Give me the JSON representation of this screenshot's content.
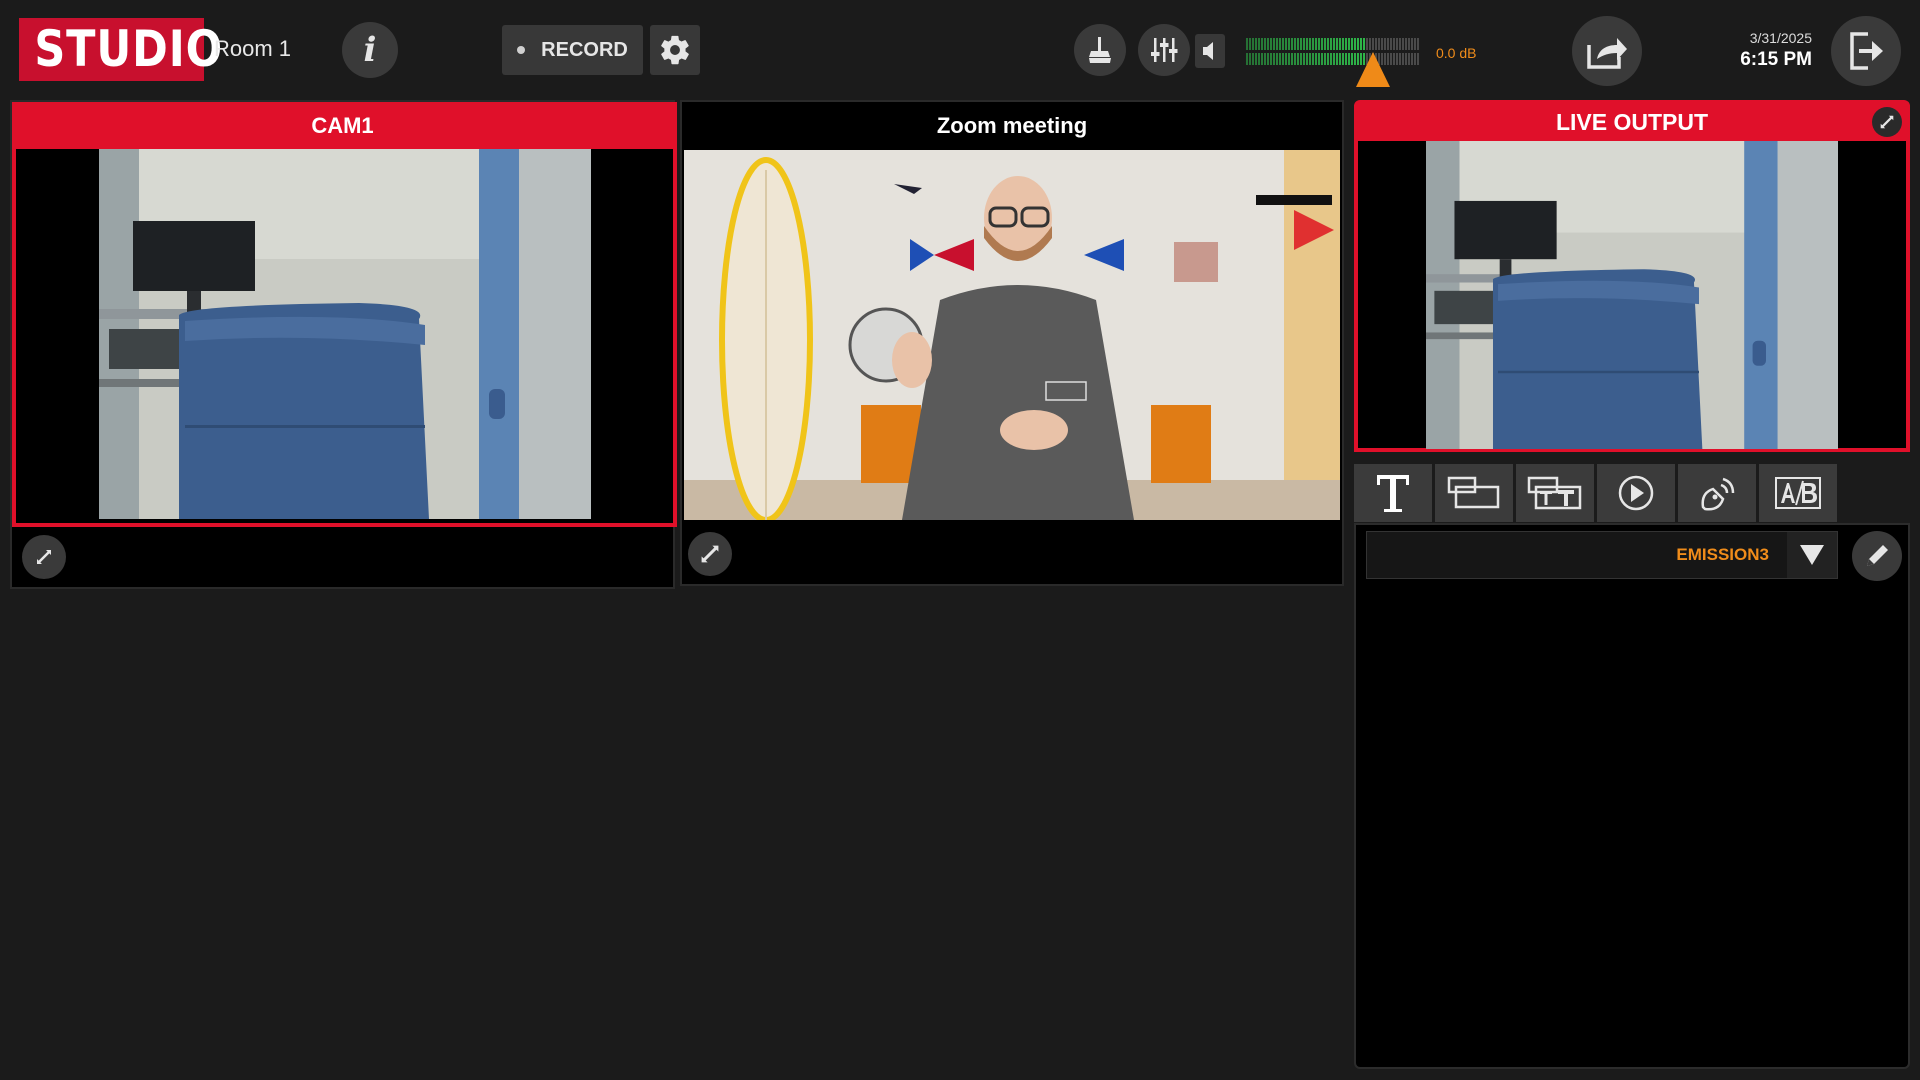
{
  "header": {
    "logo_text": "STUDIO",
    "room_name": "Room 1",
    "record_label": "RECORD",
    "audio_level": "0.0 dB",
    "date": "3/31/2025",
    "time": "6:15 PM"
  },
  "sources": [
    {
      "title": "CAM1",
      "state": "live"
    },
    {
      "title": "Zoom meeting",
      "state": "idle"
    }
  ],
  "live_output": {
    "title": "LIVE OUTPUT"
  },
  "tool_tabs": [
    {
      "icon": "title-text-icon",
      "active": true
    },
    {
      "icon": "lower-third-icon",
      "active": false
    },
    {
      "icon": "double-title-icon",
      "active": false
    },
    {
      "icon": "play-icon",
      "active": false
    },
    {
      "icon": "broadcast-icon",
      "active": false
    },
    {
      "icon": "ab-switch-icon",
      "active": false
    }
  ],
  "emission": {
    "selected": "EMISSION3"
  },
  "colors": {
    "brand_red": "#c8102e",
    "live_red": "#e0102a",
    "accent_orange": "#f7931e",
    "meter_green": "#2fb84a",
    "background": "#1b1b1b"
  }
}
